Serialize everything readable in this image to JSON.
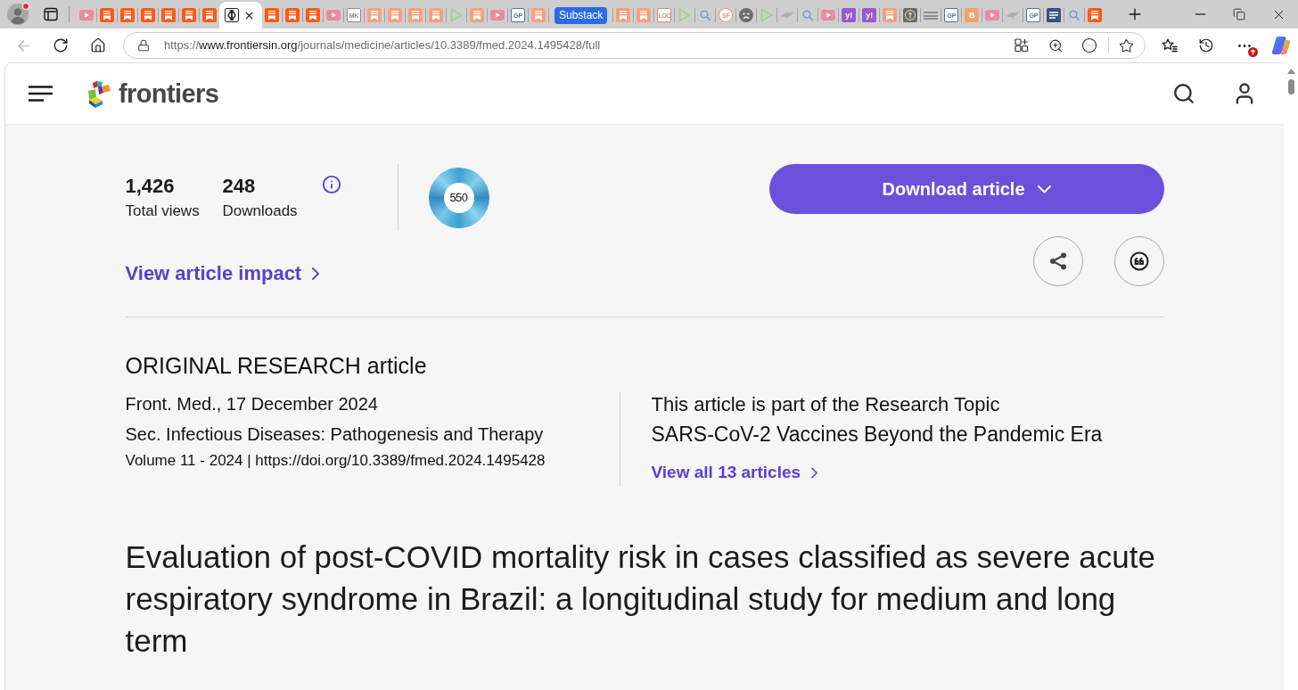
{
  "browser": {
    "profile": {
      "alert": true
    },
    "tabs": [
      {
        "kind": "video",
        "color": "#ec8aa0",
        "selected": false
      },
      {
        "kind": "bookmark",
        "color": "#ff5a14",
        "selected": false
      },
      {
        "kind": "bookmark",
        "color": "#ff5a14",
        "selected": false
      },
      {
        "kind": "bookmark",
        "color": "#ff5a14",
        "selected": false
      },
      {
        "kind": "bookmark",
        "color": "#ff5a14",
        "selected": false
      },
      {
        "kind": "bookmark",
        "color": "#ff5a14",
        "selected": false
      },
      {
        "kind": "bookmark",
        "color": "#ff5a14",
        "selected": false
      },
      {
        "kind": "symbol",
        "color": "#1f1f1f",
        "selected": true
      },
      {
        "kind": "bookmark",
        "color": "#ff5a14",
        "selected": false
      },
      {
        "kind": "bookmark",
        "color": "#ff5a14",
        "selected": false
      },
      {
        "kind": "bookmark",
        "color": "#ff5a14",
        "selected": false
      },
      {
        "kind": "video",
        "color": "#ec8aa0",
        "selected": false
      },
      {
        "kind": "monogram",
        "text": "MK",
        "color": "#8a8a8a",
        "selected": false
      },
      {
        "kind": "bookmark",
        "color": "#f2a27e",
        "selected": false
      },
      {
        "kind": "bookmark",
        "color": "#f2a27e",
        "selected": false
      },
      {
        "kind": "bookmark",
        "color": "#f2a27e",
        "selected": false
      },
      {
        "kind": "bookmark",
        "color": "#f2a27e",
        "selected": false
      },
      {
        "kind": "play",
        "color": "#9fd48a",
        "selected": false
      },
      {
        "kind": "bookmark",
        "color": "#f2a27e",
        "selected": false
      },
      {
        "kind": "video",
        "color": "#ec8aa0",
        "selected": false
      },
      {
        "kind": "monogram",
        "text": "GP",
        "color": "#5c6fa0",
        "selected": false
      },
      {
        "kind": "bookmark",
        "color": "#f2a27e",
        "selected": false
      },
      {
        "kind": "badge",
        "text": "Substack",
        "color": "#2b6be6",
        "selected": false
      },
      {
        "kind": "bookmark",
        "color": "#f2a27e",
        "selected": false
      },
      {
        "kind": "bookmark",
        "color": "#f2a27e",
        "selected": false
      },
      {
        "kind": "monogram",
        "text": "LOC",
        "color": "#e2866c",
        "selected": false
      },
      {
        "kind": "play",
        "color": "#9fd48a",
        "selected": false
      },
      {
        "kind": "search",
        "color": "#6a9fd8",
        "selected": false
      },
      {
        "kind": "seal",
        "text": "SF",
        "color": "#e8956b",
        "selected": false
      },
      {
        "kind": "face",
        "color": "#6f6f6f",
        "selected": false
      },
      {
        "kind": "play",
        "color": "#9fd48a",
        "selected": false
      },
      {
        "kind": "bird",
        "color": "#b0b0b0",
        "selected": false
      },
      {
        "kind": "search",
        "color": "#6a9fd8",
        "selected": false
      },
      {
        "kind": "video",
        "color": "#ec8aa0",
        "selected": false
      },
      {
        "kind": "block",
        "text": "y!",
        "color": "#9a57d4",
        "selected": false
      },
      {
        "kind": "block",
        "text": "y!",
        "color": "#9a57d4",
        "selected": false
      },
      {
        "kind": "bookmark",
        "color": "#f2a27e",
        "selected": false
      },
      {
        "kind": "medallion",
        "color": "#6b6b6b",
        "selected": false
      },
      {
        "kind": "lines",
        "color": "#8e8e8e",
        "selected": false
      },
      {
        "kind": "monogram",
        "text": "GP",
        "color": "#5c6fa0",
        "selected": false
      },
      {
        "kind": "block",
        "text": "B",
        "color": "#f2a070",
        "selected": false
      },
      {
        "kind": "video",
        "color": "#ec8aa0",
        "selected": false
      },
      {
        "kind": "bird",
        "color": "#b0b0b0",
        "selected": false
      },
      {
        "kind": "monogram",
        "text": "GP",
        "color": "#5c6fa0",
        "selected": false
      },
      {
        "kind": "news",
        "color": "#3b4f86",
        "selected": false
      },
      {
        "kind": "search",
        "color": "#6a9fd8",
        "selected": false
      },
      {
        "kind": "bookmark",
        "color": "#ff5a14",
        "selected": false
      }
    ],
    "back": {
      "disabled": true
    },
    "address": {
      "scheme": "https://",
      "host": "www.frontiersin.org",
      "path": "/journals/medicine/articles/10.3389/fmed.2024.1495428/full"
    },
    "menu": {
      "update_badge": true
    }
  },
  "header": {
    "logo": "frontiers"
  },
  "metrics": {
    "stats": [
      {
        "value": "1,426",
        "label": "Total views"
      },
      {
        "value": "248",
        "label": "Downloads"
      }
    ],
    "altmetric_score": "550",
    "impact_link": "View article impact"
  },
  "actions": {
    "download": "Download article"
  },
  "article": {
    "type": "ORIGINAL RESEARCH article",
    "journal_date": "Front. Med., 17 December 2024",
    "section": "Sec. Infectious Diseases: Pathogenesis and Therapy",
    "volume_doi": "Volume 11 - 2024 | https://doi.org/10.3389/fmed.2024.1495428",
    "topic": {
      "intro": "This article is part of the Research Topic",
      "name": "SARS-CoV-2 Vaccines Beyond the Pandemic Era",
      "link": "View all 13 articles"
    },
    "title": "Evaluation of post-COVID mortality risk in cases classified as severe acute respiratory syndrome in Brazil: a longitudinal study for medium and long term"
  }
}
